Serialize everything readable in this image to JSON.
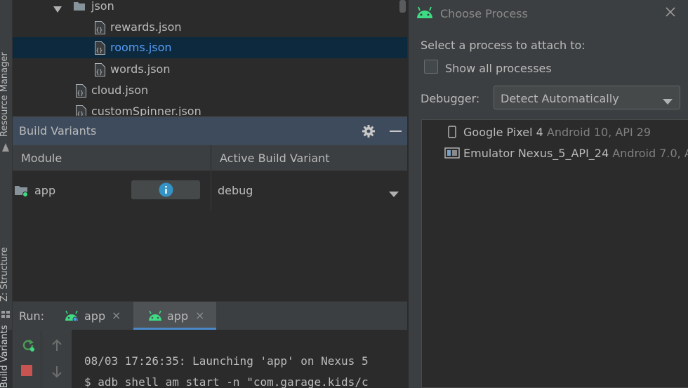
{
  "side_strip": {
    "labels": [
      "Resource Manager",
      "Z: Structure",
      "Build Variants"
    ]
  },
  "project_tree": {
    "items": [
      {
        "label": "json",
        "type": "folder",
        "expanded": true,
        "selected": false
      },
      {
        "label": "rewards.json",
        "type": "json-file",
        "selected": false
      },
      {
        "label": "rooms.json",
        "type": "json-file",
        "selected": true
      },
      {
        "label": "words.json",
        "type": "json-file",
        "selected": false
      },
      {
        "label": "cloud.json",
        "type": "json-file",
        "selected": false
      },
      {
        "label": "customSpinner.json",
        "type": "json-file",
        "selected": false
      }
    ]
  },
  "build_variants": {
    "title": "Build Variants",
    "columns": [
      "Module",
      "Active Build Variant"
    ],
    "rows": [
      {
        "module": "app",
        "variant": "debug"
      }
    ]
  },
  "run_panel": {
    "label": "Run:",
    "tabs": [
      {
        "label": "app",
        "active": false
      },
      {
        "label": "app",
        "active": true
      }
    ],
    "console_lines": [
      "08/03 17:26:35: Launching 'app' on Nexus 5",
      "$ adb shell am start -n \"com.garage.kids/c"
    ]
  },
  "dialog": {
    "title": "Choose Process",
    "prompt": "Select a process to attach to:",
    "show_all_label": "Show all processes",
    "show_all_checked": false,
    "debugger_label": "Debugger:",
    "debugger_value": "Detect Automatically",
    "devices": [
      {
        "name": "Google Pixel 4",
        "detail": "Android 10, API 29",
        "kind": "phone-icon"
      },
      {
        "name": "Emulator Nexus_5_API_24",
        "detail": "Android 7.0, A",
        "kind": "emulator-icon"
      }
    ]
  },
  "colors": {
    "background": "#2b2b2b",
    "panel": "#3c3f41",
    "selection": "#0d293e",
    "selected_text": "#589df6",
    "header_active": "#3d4b5c",
    "android_green": "#3ddc84",
    "info_blue": "#3592c4",
    "stop_red": "#c75450"
  }
}
